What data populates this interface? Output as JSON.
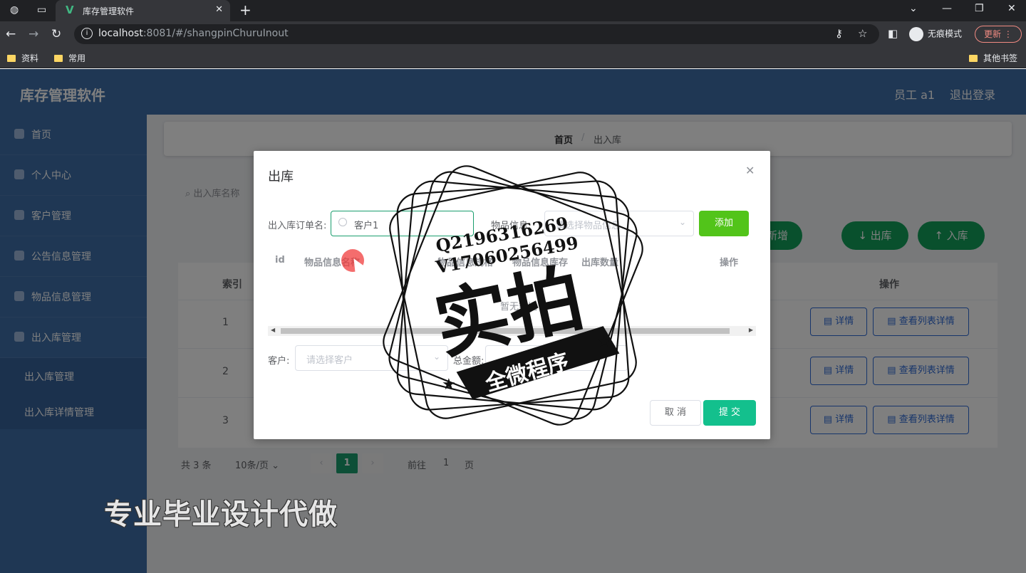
{
  "browser": {
    "tab_title": "库存管理软件",
    "url_host": "localhost",
    "url_rest": ":8081/#/shangpinChuruInout",
    "incognito_label": "无痕模式",
    "update_label": "更新",
    "bookmarks": [
      "资料",
      "常用"
    ],
    "other_bookmarks": "其他书签"
  },
  "app": {
    "title": "库存管理软件",
    "user": "员工 a1",
    "logout": "退出登录"
  },
  "sidebar": {
    "items": [
      {
        "label": "首页"
      },
      {
        "label": "个人中心"
      },
      {
        "label": "客户管理"
      },
      {
        "label": "公告信息管理"
      },
      {
        "label": "物品信息管理"
      },
      {
        "label": "出入库管理"
      }
    ],
    "subitems": [
      {
        "label": "出入库管理"
      },
      {
        "label": "出入库详情管理"
      }
    ]
  },
  "breadcrumb": {
    "home": "首页",
    "sep": "/",
    "current": "出入库"
  },
  "search": {
    "placeholder": "出入库名称"
  },
  "actions": {
    "add": "新增",
    "out": "↓ 出库",
    "in": "↑ 入库"
  },
  "table": {
    "headers": {
      "index": "索引",
      "ops": "操作"
    },
    "rows": [
      {
        "index": "1",
        "detail": "详情",
        "list_detail": "查看列表详情"
      },
      {
        "index": "2",
        "detail": "详情",
        "list_detail": "查看列表详情"
      },
      {
        "index": "3",
        "detail": "详情",
        "list_detail": "查看列表详情"
      }
    ]
  },
  "pagination": {
    "total": "共 3 条",
    "page_size": "10条/页",
    "current": "1",
    "goto": "前往",
    "goto_value": "1",
    "page_unit": "页"
  },
  "dialog": {
    "title": "出库",
    "order_label": "出入库订单名:",
    "order_value": "客户1",
    "item_label": "物品信息:",
    "item_placeholder": "请选择物品信息",
    "add_button": "添加",
    "cols": {
      "id": "id",
      "item_name": "物品信息名称",
      "item_spec": "物品信息规格",
      "item_stock": "物品信息库存",
      "out_qty": "出库数量",
      "ops": "操作"
    },
    "empty": "暂无数据",
    "customer_label": "客户:",
    "customer_placeholder": "请选择客户",
    "total_label": "总金额:",
    "cancel": "取 消",
    "submit": "提 交"
  },
  "watermark": {
    "line1": "Q2196316269",
    "line2": "V17060256499",
    "big": "实拍",
    "ribbon": "全微程序",
    "banner": "专业毕业设计代做"
  },
  "colors": {
    "brand": "#3e6ea8",
    "accent": "#1a9e6e",
    "add_green": "#52c41a",
    "submit": "#13c08d"
  }
}
